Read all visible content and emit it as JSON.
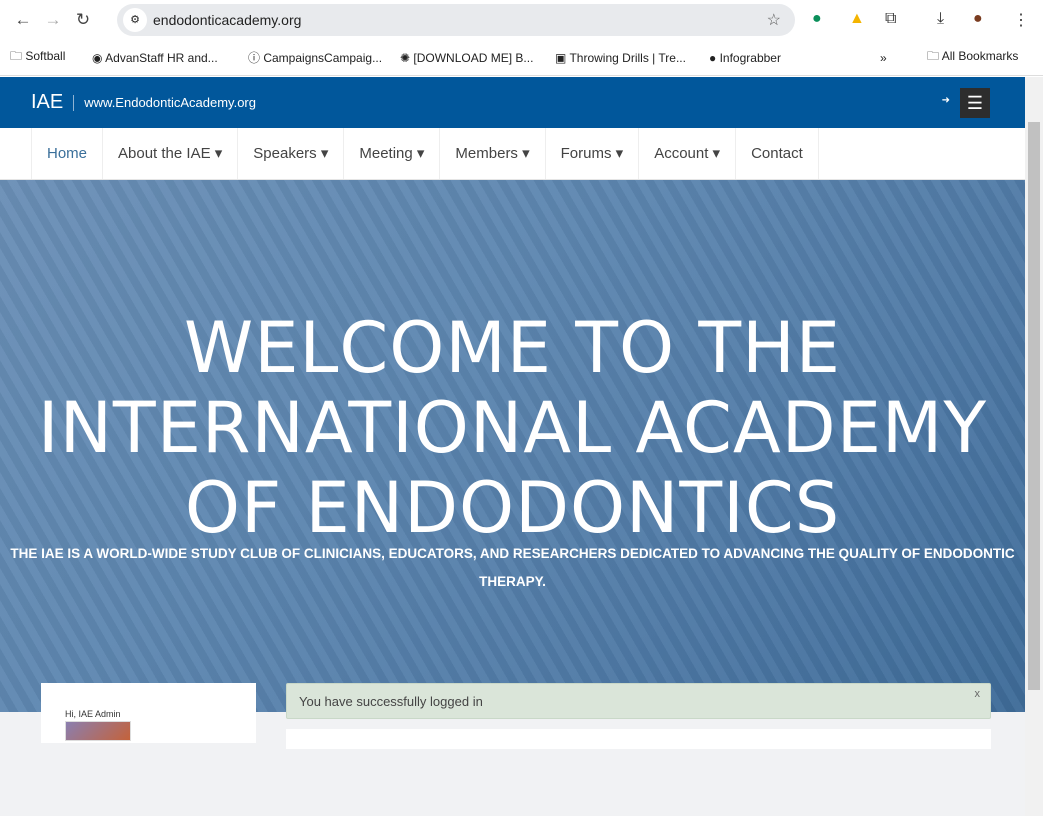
{
  "browser": {
    "url": "endodonticacademy.org",
    "bookmarks": [
      "Softball",
      "AdvanStaff HR and...",
      "CampaignsCampaig...",
      "[DOWNLOAD ME] B...",
      "Throwing Drills | Tre...",
      "Infograbber"
    ],
    "all_bookmarks": "All Bookmarks",
    "overflow": "»"
  },
  "site": {
    "logo": "IAE",
    "domain": "www.EndodonticAcademy.org",
    "menu": [
      "Home",
      "About the IAE ▾",
      "Speakers ▾",
      "Meeting ▾",
      "Members ▾",
      "Forums ▾",
      "Account ▾",
      "Contact"
    ],
    "hero_title": "WELCOME TO THE INTERNATIONAL ACADEMY OF ENDODONTICS",
    "hero_subtitle": "THE IAE IS A WORLD-WIDE STUDY CLUB OF CLINICIANS, EDUCATORS, AND RESEARCHERS DEDICATED TO ADVANCING THE QUALITY OF ENDODONTIC THERAPY.",
    "greeting": "Hi, IAE Admin",
    "alert": "You have successfully logged in",
    "alert_close": "x"
  }
}
